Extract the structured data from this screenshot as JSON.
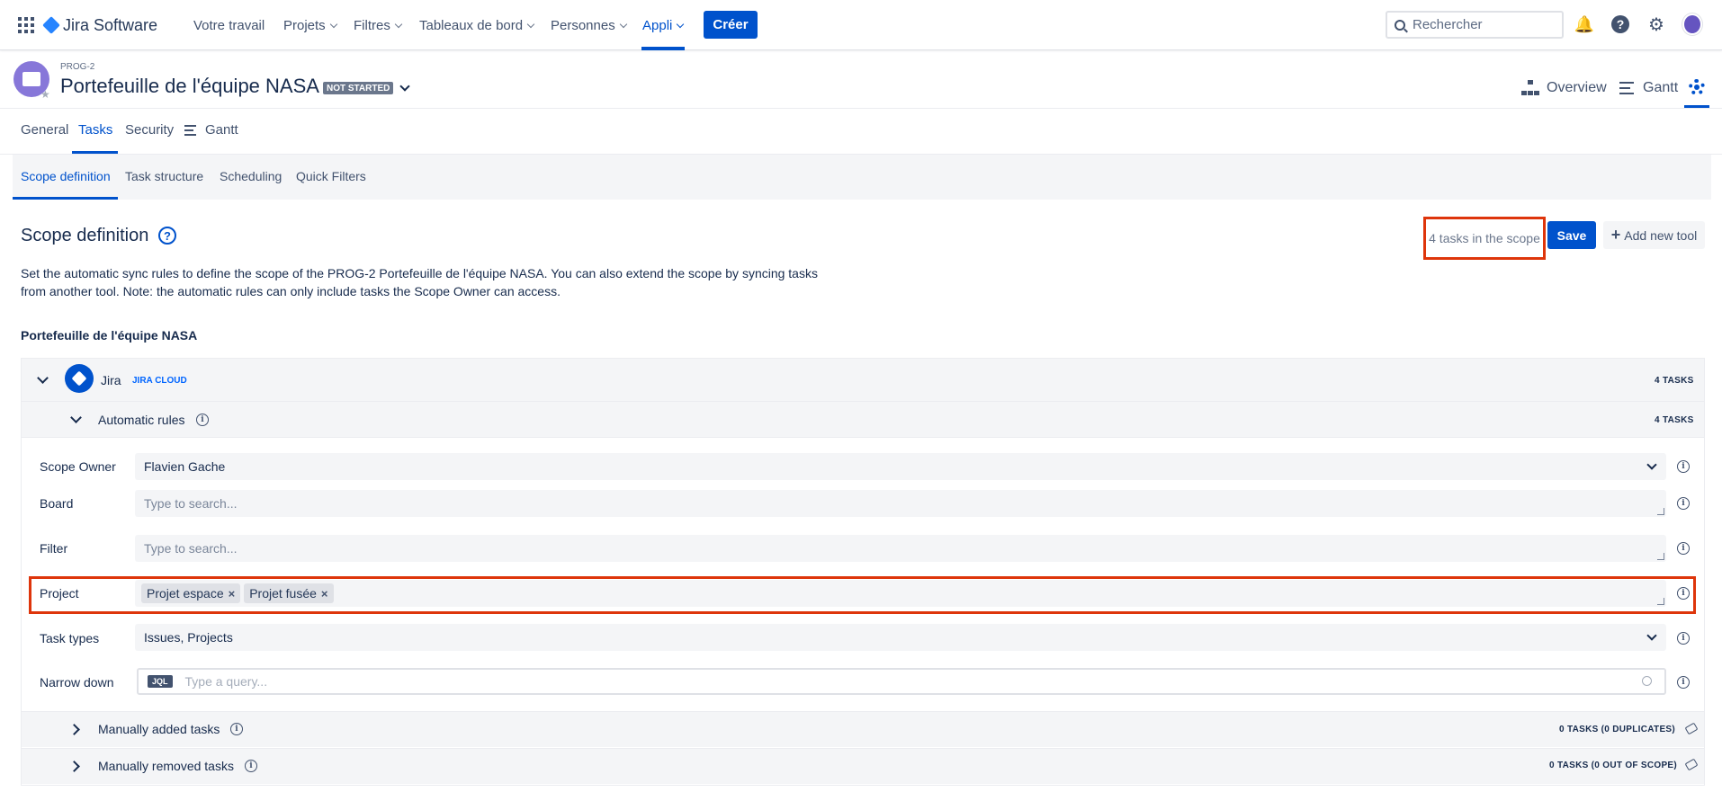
{
  "topnav": {
    "app_name": "Jira Software",
    "items": [
      {
        "label": "Votre travail"
      },
      {
        "label": "Projets"
      },
      {
        "label": "Filtres"
      },
      {
        "label": "Tableaux de bord"
      },
      {
        "label": "Personnes"
      },
      {
        "label": "Appli"
      }
    ],
    "create_label": "Créer",
    "search_placeholder": "Rechercher"
  },
  "project": {
    "key": "PROG-2",
    "title": "Portefeuille de l'équipe NASA",
    "status": "NOT STARTED",
    "overview_label": "Overview",
    "gantt_label": "Gantt"
  },
  "tabs": [
    {
      "label": "General"
    },
    {
      "label": "Tasks"
    },
    {
      "label": "Security"
    },
    {
      "label": "Gantt"
    }
  ],
  "subtabs": [
    {
      "label": "Scope definition"
    },
    {
      "label": "Task structure"
    },
    {
      "label": "Scheduling"
    },
    {
      "label": "Quick Filters"
    }
  ],
  "scope": {
    "title": "Scope definition",
    "tasks_in_scope": "4 tasks in the scope",
    "save_label": "Save",
    "add_tool_label": "Add new tool",
    "description": "Set the automatic sync rules to define the scope of the PROG-2 Portefeuille de l'équipe NASA. You can also extend the scope by syncing tasks from another tool. Note: the automatic rules can only include tasks the Scope Owner can access.",
    "portfolio_label": "Portefeuille de l'équipe NASA"
  },
  "jira": {
    "name": "Jira",
    "lozenge": "JIRA CLOUD",
    "count": "4 TASKS",
    "auto_rules_label": "Automatic rules",
    "auto_rules_count": "4 TASKS"
  },
  "rules": {
    "scope_owner": {
      "label": "Scope Owner",
      "value": "Flavien Gache"
    },
    "board": {
      "label": "Board",
      "placeholder": "Type to search..."
    },
    "filter": {
      "label": "Filter",
      "placeholder": "Type to search..."
    },
    "project": {
      "label": "Project",
      "tags": [
        "Projet espace",
        "Projet fusée"
      ]
    },
    "task_types": {
      "label": "Task types",
      "value": "Issues, Projects"
    },
    "narrow_down": {
      "label": "Narrow down",
      "badge": "JQL",
      "placeholder": "Type a query..."
    }
  },
  "manual": {
    "added_label": "Manually added tasks",
    "added_count": "0 TASKS (0 DUPLICATES)",
    "removed_label": "Manually removed tasks",
    "removed_count": "0 TASKS (0 OUT OF SCOPE)"
  },
  "colors": {
    "accent": "#0052cc",
    "highlight": "#de350b"
  }
}
